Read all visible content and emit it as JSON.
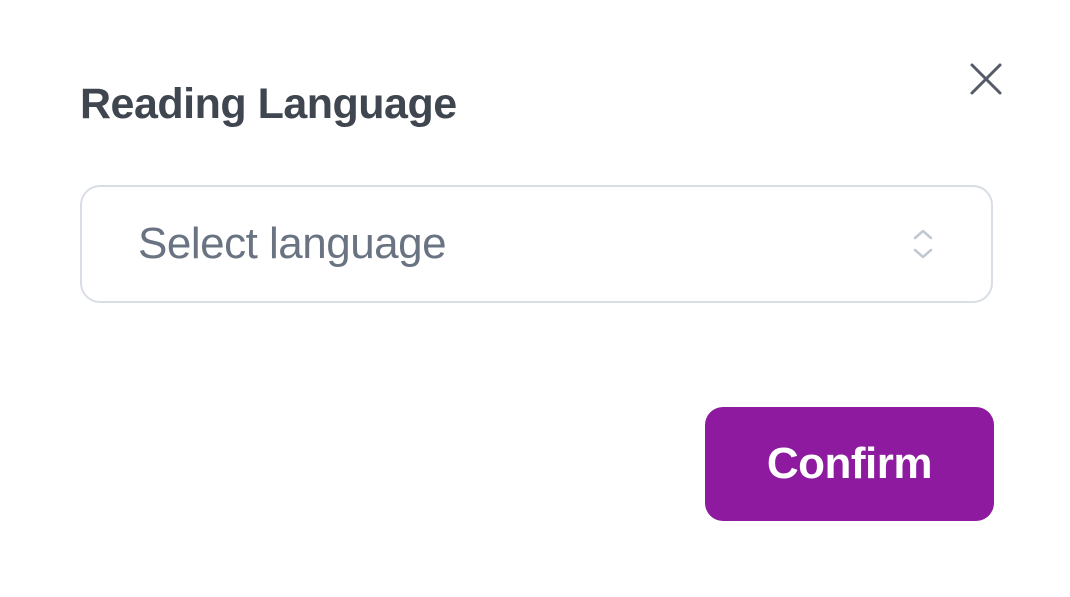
{
  "modal": {
    "title": "Reading Language",
    "close_icon": "close",
    "select": {
      "placeholder": "Select language",
      "selected": null
    },
    "confirm_label": "Confirm"
  },
  "colors": {
    "accent": "#8D1A9F",
    "title": "#3F464F",
    "placeholder": "#6A7382",
    "border": "#D9DEE6",
    "chevron": "#C1C8D4",
    "close": "#545B66"
  }
}
